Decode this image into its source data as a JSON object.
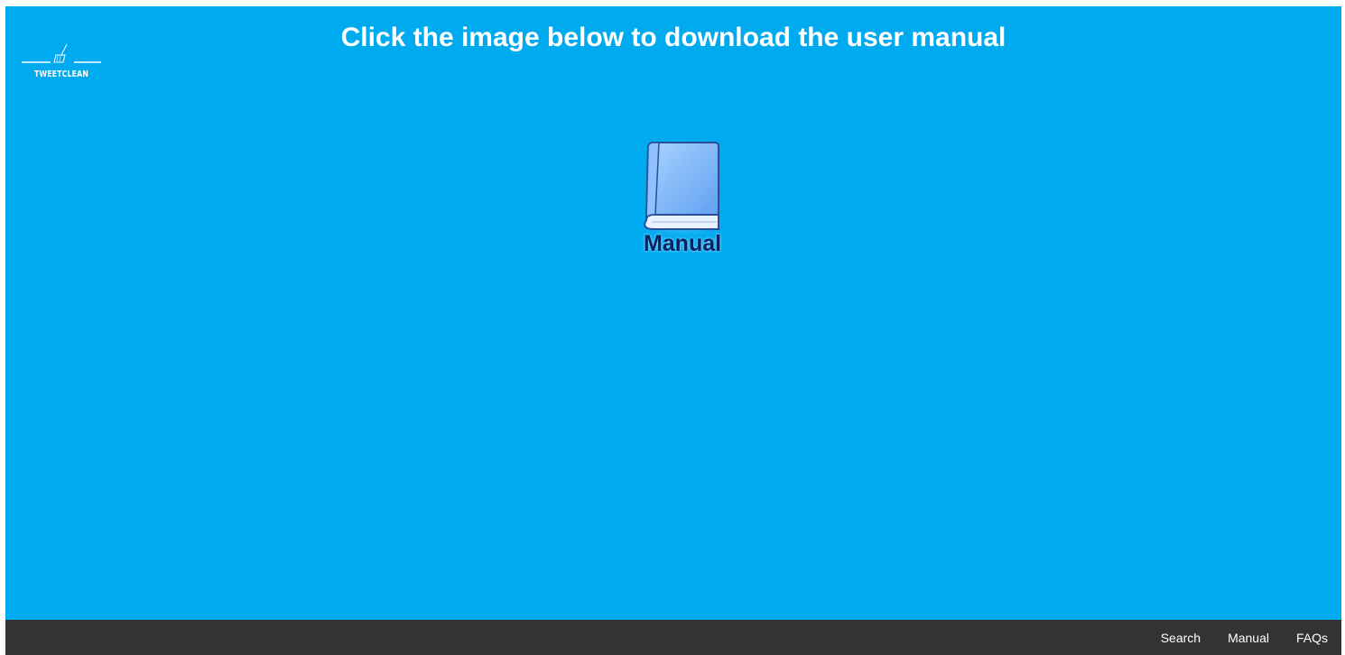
{
  "logo": {
    "text": "TWEETCLEAN",
    "icon": "broom-icon"
  },
  "header": {
    "title": "Click the image below to download the user manual"
  },
  "manual": {
    "icon": "book-icon",
    "label": "Manual"
  },
  "footer": {
    "links": [
      {
        "label": "Search"
      },
      {
        "label": "Manual"
      },
      {
        "label": "FAQs"
      }
    ]
  },
  "colors": {
    "background": "#00aaef",
    "footer": "#333333",
    "text": "#ffffff",
    "manual_label": "#0b2160"
  }
}
